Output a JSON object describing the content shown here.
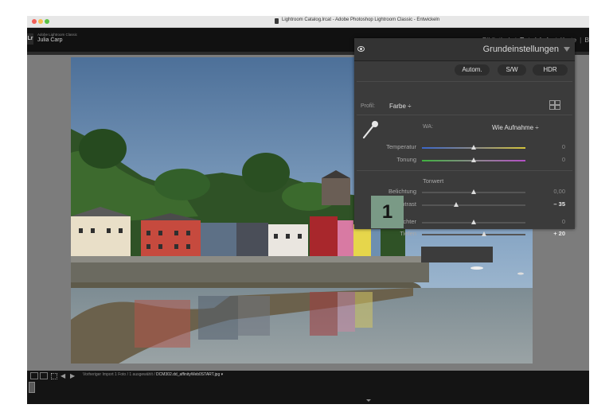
{
  "window": {
    "title": "Lightroom Catalog.lrcat - Adobe Photoshop Lightroom Classic - Entwickeln"
  },
  "identity": {
    "product": "Adobe Lightroom Classic",
    "user": "Julia Carp"
  },
  "modules": {
    "items": [
      "Bibliothek",
      "Entwickeln",
      "Karte",
      "B"
    ],
    "active": "Entwickeln"
  },
  "panel": {
    "title": "Grundeinstellungen",
    "buttons": {
      "auto": "Autom.",
      "sw": "S/W",
      "hdr": "HDR"
    },
    "profile": {
      "label": "Profil:",
      "value": "Farbe ÷"
    },
    "wb": {
      "label": "WA:",
      "value": "Wie Aufnahme ÷"
    },
    "sliders": {
      "temperatur": {
        "label": "Temperatur",
        "value": "0",
        "position": 0.5
      },
      "tonung": {
        "label": "Tonung",
        "value": "0",
        "position": 0.5
      },
      "tonwert_label": "Tonwert",
      "belichtung": {
        "label": "Belichtung",
        "value": "0,00",
        "position": 0.5
      },
      "kontrast": {
        "label": "Kontrast",
        "value": "– 35",
        "position": 0.33
      },
      "lichter": {
        "label": "Lichter",
        "value": "0",
        "position": 0.5
      },
      "tiefen": {
        "label": "Tiefen",
        "value": "+ 20",
        "position": 0.6
      }
    }
  },
  "callout": {
    "number": "1",
    "color": "#7a9a86"
  },
  "filmstrip": {
    "source": "Vorheriger Import",
    "info": "1 Foto / 1 ausgewählt /",
    "filename": "DCM302.dd_affinityWeb0START.jpg ▾"
  },
  "icons": [
    "eye-icon",
    "collapse-icon",
    "grid-icon",
    "eyedropper-icon",
    "lightroom-logo",
    "grid-view-icon",
    "arrow-left-icon",
    "arrow-right-icon"
  ]
}
